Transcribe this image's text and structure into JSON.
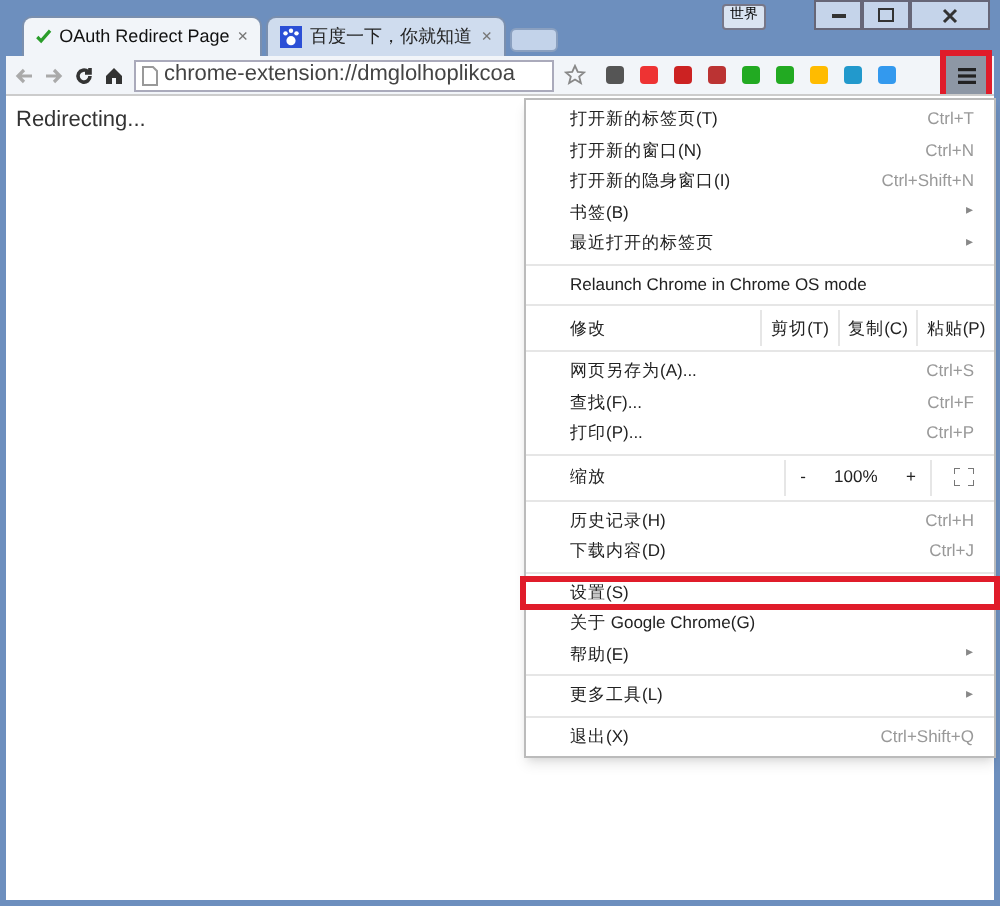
{
  "tabs": [
    {
      "title": "OAuth Redirect Page",
      "close": "×",
      "selected": true,
      "kind": "check"
    },
    {
      "title": "百度一下，你就知道",
      "close": "×",
      "selected": false,
      "kind": "paw"
    }
  ],
  "profile_badge": "世界",
  "address_bar": {
    "value": "chrome-extension://dmglolhoplikcoa"
  },
  "page": {
    "text": "Redirecting..."
  },
  "menu_button": {
    "highlighted": true
  },
  "menu": [
    {
      "kind": "item",
      "label": "打开新的标签页(T)",
      "shortcut": "Ctrl+T",
      "highlighted": false
    },
    {
      "kind": "item",
      "label": "打开新的窗口(N)",
      "shortcut": "Ctrl+N",
      "highlighted": false
    },
    {
      "kind": "item",
      "label": "打开新的隐身窗口(I)",
      "shortcut": "Ctrl+Shift+N",
      "highlighted": false
    },
    {
      "kind": "item",
      "label": "书签(B)",
      "submenu": "▸",
      "highlighted": false
    },
    {
      "kind": "item",
      "label": "最近打开的标签页",
      "submenu": "▸",
      "highlighted": false
    },
    {
      "kind": "separator"
    },
    {
      "kind": "item",
      "label": "Relaunch Chrome in Chrome OS mode",
      "highlighted": false
    },
    {
      "kind": "separator"
    },
    {
      "kind": "edit",
      "label": "修改",
      "buttons": [
        "剪切(T)",
        "复制(C)",
        "粘贴(P)"
      ]
    },
    {
      "kind": "separator"
    },
    {
      "kind": "item",
      "label": "网页另存为(A)...",
      "shortcut": "Ctrl+S",
      "highlighted": false
    },
    {
      "kind": "item",
      "label": "查找(F)...",
      "shortcut": "Ctrl+F",
      "highlighted": false
    },
    {
      "kind": "item",
      "label": "打印(P)...",
      "shortcut": "Ctrl+P",
      "highlighted": false
    },
    {
      "kind": "separator"
    },
    {
      "kind": "zoom",
      "label": "缩放",
      "minus": "-",
      "value": "100%",
      "plus": "+"
    },
    {
      "kind": "separator"
    },
    {
      "kind": "item",
      "label": "历史记录(H)",
      "shortcut": "Ctrl+H",
      "highlighted": false
    },
    {
      "kind": "item",
      "label": "下载内容(D)",
      "shortcut": "Ctrl+J",
      "highlighted": false
    },
    {
      "kind": "separator"
    },
    {
      "kind": "item",
      "label": "设置(S)",
      "highlighted": true
    },
    {
      "kind": "item",
      "label": "关于 Google Chrome(G)",
      "highlighted": false
    },
    {
      "kind": "item",
      "label": "帮助(E)",
      "submenu": "▸",
      "highlighted": false
    },
    {
      "kind": "separator"
    },
    {
      "kind": "item",
      "label": "更多工具(L)",
      "submenu": "▸",
      "highlighted": false
    },
    {
      "kind": "separator"
    },
    {
      "kind": "item",
      "label": "退出(X)",
      "shortcut": "Ctrl+Shift+Q",
      "highlighted": false
    }
  ]
}
